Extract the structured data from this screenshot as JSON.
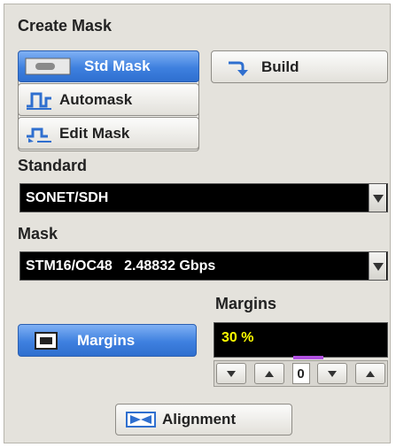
{
  "create_mask": {
    "title": "Create Mask",
    "std_mask_label": "Std Mask",
    "automask_label": "Automask",
    "edit_mask_label": "Edit Mask",
    "build_label": "Build"
  },
  "standard": {
    "title": "Standard",
    "value": "SONET/SDH"
  },
  "mask": {
    "title": "Mask",
    "value": "STM16/OC48   2.48832 Gbps"
  },
  "margins": {
    "title": "Margins",
    "toggle_label": "Margins",
    "value": "30 %",
    "step_value": "0"
  },
  "alignment_label": "Alignment",
  "colors": {
    "selected_blue": "#3e80df",
    "panel_bg": "#e4e2dc",
    "display_text": "#ffff00"
  }
}
